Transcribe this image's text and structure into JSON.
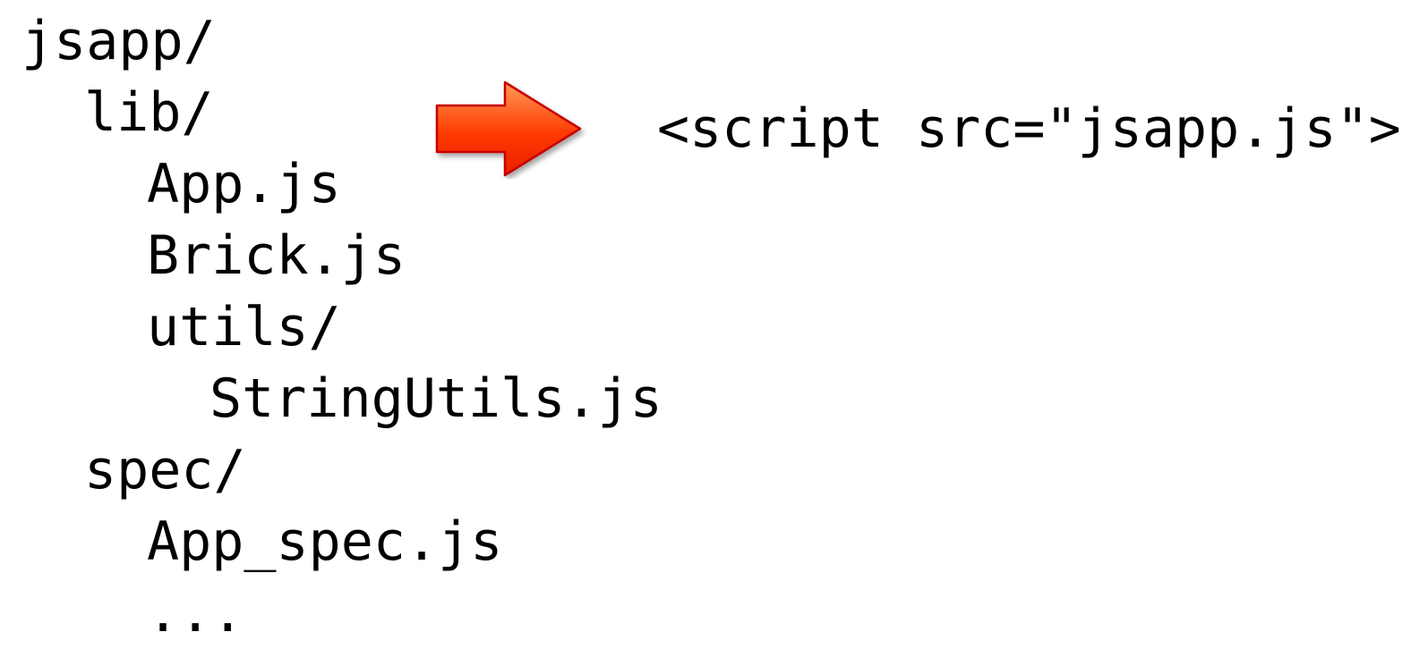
{
  "tree": {
    "items": [
      {
        "label": "jsapp/",
        "depth": 0
      },
      {
        "label": "lib/",
        "depth": 1
      },
      {
        "label": "App.js",
        "depth": 2
      },
      {
        "label": "Brick.js",
        "depth": 2
      },
      {
        "label": "utils/",
        "depth": 2
      },
      {
        "label": "StringUtils.js",
        "depth": 3
      },
      {
        "label": "spec/",
        "depth": 1
      },
      {
        "label": "App_spec.js",
        "depth": 2
      },
      {
        "label": "...",
        "depth": 2
      }
    ]
  },
  "arrow": {
    "icon": "right-arrow-icon",
    "color_top": "#ff9a5a",
    "color_bottom": "#e81e00",
    "border": "#c70000"
  },
  "script_tag": {
    "text": "<script src=\"jsapp.js\">"
  }
}
